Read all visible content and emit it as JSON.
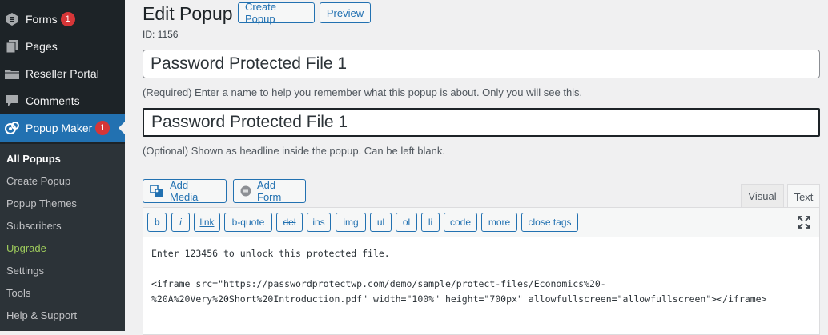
{
  "sidebar": {
    "items": [
      {
        "label": "Forms",
        "icon": "forms-icon",
        "badge": "1"
      },
      {
        "label": "Pages",
        "icon": "pages-icon"
      },
      {
        "label": "Reseller Portal",
        "icon": "folder-icon"
      },
      {
        "label": "Comments",
        "icon": "comment-icon"
      },
      {
        "label": "Popup Maker",
        "icon": "popup-maker-icon",
        "badge": "1",
        "active": true
      }
    ],
    "submenu": [
      "All Popups",
      "Create Popup",
      "Popup Themes",
      "Subscribers",
      "Upgrade",
      "Settings",
      "Tools",
      "Help & Support"
    ]
  },
  "header": {
    "title": "Edit Popup",
    "create_label": "Create Popup",
    "preview_label": "Preview",
    "id_text": "ID: 1156"
  },
  "form": {
    "name_value": "Password Protected File 1",
    "name_help": "(Required) Enter a name to help you remember what this popup is about. Only you will see this.",
    "title_value": "Password Protected File 1",
    "title_help": "(Optional) Shown as headline inside the popup. Can be left blank."
  },
  "editor": {
    "add_media_label": "Add Media",
    "add_form_label": "Add Form",
    "tab_visual": "Visual",
    "tab_text": "Text",
    "quicktags": [
      "b",
      "i",
      "link",
      "b-quote",
      "del",
      "ins",
      "img",
      "ul",
      "ol",
      "li",
      "code",
      "more",
      "close tags"
    ],
    "content": {
      "line1": "Enter 123456 to unlock this protected file.",
      "line2": "<iframe src=\"https://passwordprotectwp.com/demo/sample/protect-files/Economics%20-",
      "line3": "%20A%20Very%20Short%20Introduction.pdf\" width=\"100%\" height=\"700px\" allowfullscreen=\"allowfullscreen\"></iframe>"
    }
  },
  "colors": {
    "sidebar_bg": "#1d2327",
    "submenu_bg": "#2c3338",
    "accent": "#2271b1",
    "badge": "#d63638",
    "upgrade": "#9ecb5c"
  }
}
